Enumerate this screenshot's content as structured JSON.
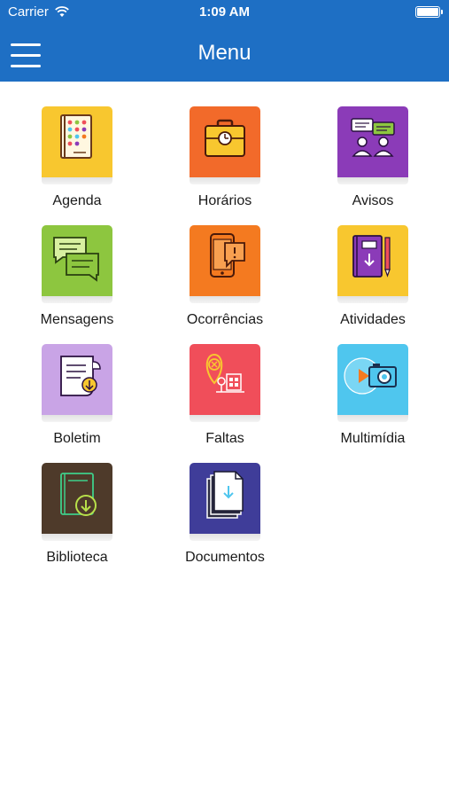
{
  "status_bar": {
    "carrier": "Carrier",
    "time": "1:09 AM"
  },
  "header": {
    "title": "Menu",
    "background_color": "#1e6fc4",
    "menu_icon": "hamburger-icon"
  },
  "menu_items": [
    {
      "label": "Agenda",
      "color": "#f8c72f",
      "icon": "agenda-icon"
    },
    {
      "label": "Horários",
      "color": "#f26a2a",
      "icon": "briefcase-clock-icon"
    },
    {
      "label": "Avisos",
      "color": "#8b3bb8",
      "icon": "people-talking-icon"
    },
    {
      "label": "Mensagens",
      "color": "#8dc63f",
      "icon": "chat-bubbles-icon"
    },
    {
      "label": "Ocorrências",
      "color": "#f47a20",
      "icon": "phone-alert-icon"
    },
    {
      "label": "Atividades",
      "color": "#f8c72f",
      "icon": "notebook-pencil-icon"
    },
    {
      "label": "Boletim",
      "color": "#c9a4e6",
      "icon": "report-card-icon"
    },
    {
      "label": "Faltas",
      "color": "#f04e5a",
      "icon": "location-absence-icon"
    },
    {
      "label": "Multimídia",
      "color": "#4fc6ee",
      "icon": "camera-media-icon"
    },
    {
      "label": "Biblioteca",
      "color": "#4e3a2a",
      "icon": "book-download-icon"
    },
    {
      "label": "Documentos",
      "color": "#3f3d99",
      "icon": "documents-icon"
    }
  ]
}
